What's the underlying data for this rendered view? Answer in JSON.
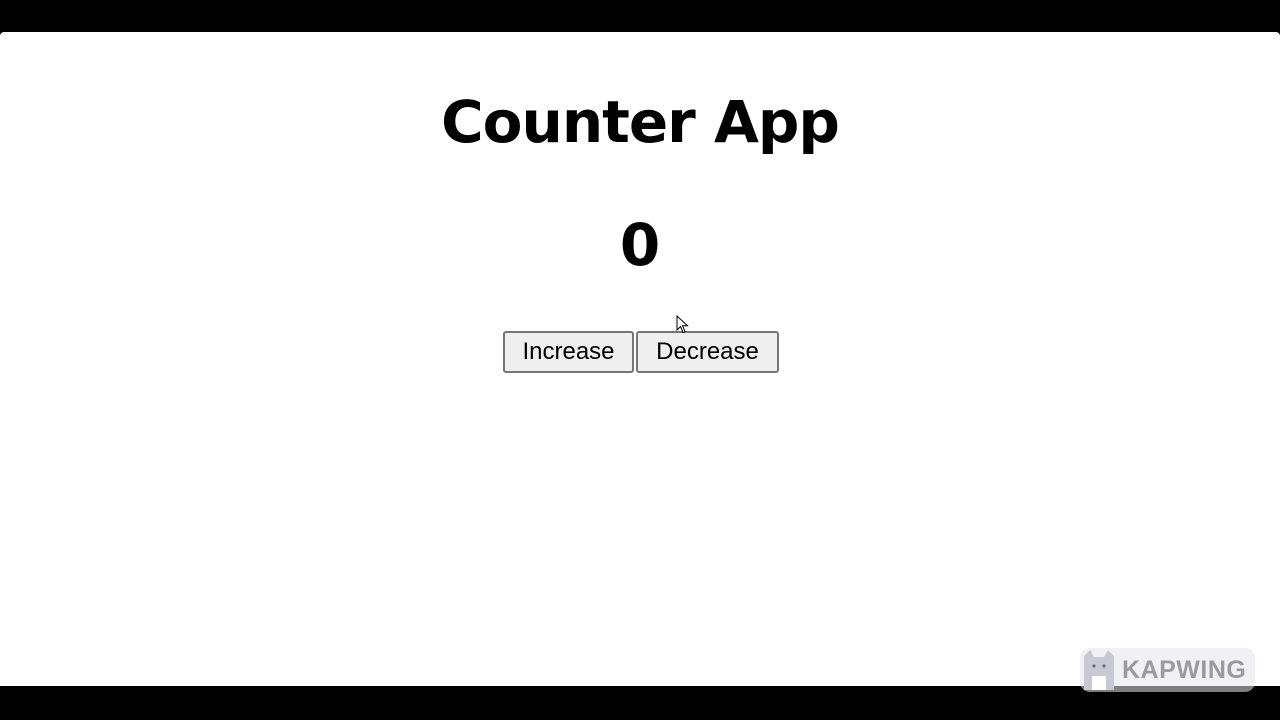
{
  "app": {
    "title": "Counter App",
    "count": "0"
  },
  "buttons": {
    "increase_label": "Increase",
    "decrease_label": "Decrease"
  },
  "watermark": {
    "text": "KAPWING",
    "icon": "kapwing-cat-logo-icon"
  },
  "colors": {
    "page_background": "#ffffff",
    "letterbox": "#000000",
    "button_background": "#efefef",
    "button_border": "#767676",
    "watermark_text": "#9a9aa3"
  },
  "cursor": {
    "icon": "mouse-pointer-icon"
  }
}
